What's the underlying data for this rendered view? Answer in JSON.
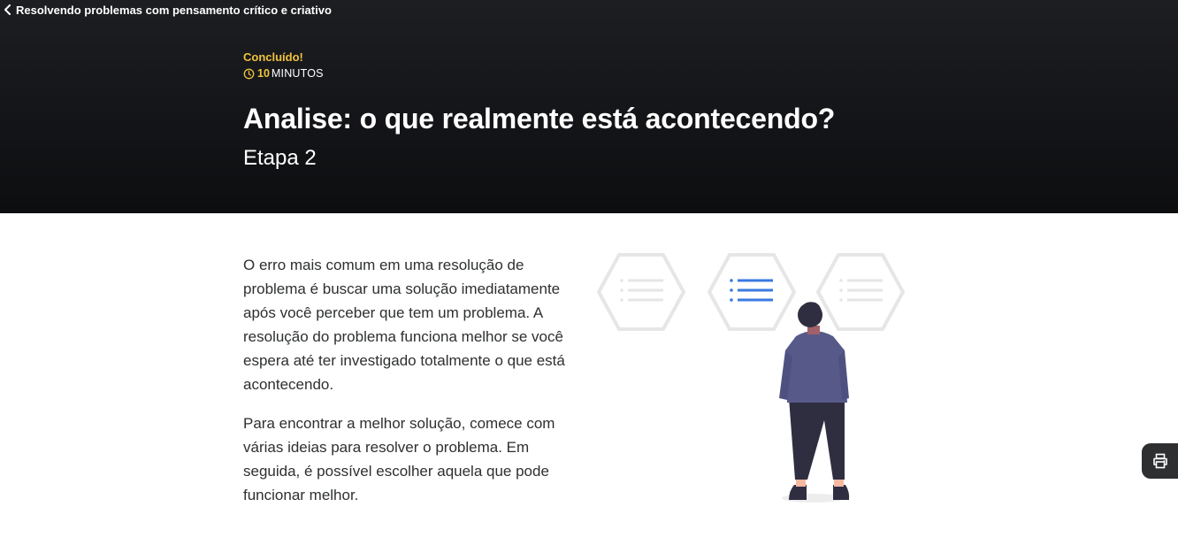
{
  "header": {
    "back_label": "Resolvendo problemas com pensamento crítico e criativo",
    "status": "Concluído!",
    "duration_value": "10",
    "duration_unit": "MINUTOS",
    "title": "Analise: o que realmente está acontecendo?",
    "subtitle": "Etapa 2"
  },
  "content": {
    "paragraphs": [
      "O erro mais comum em uma resolução de problema é buscar uma solução imediatamente após você perceber que tem um problema. A resolução do problema funciona melhor se você espera até ter investigado totalmente o que está acontecendo.",
      "Para encontrar a melhor solução, comece com várias ideias para resolver o problema. Em seguida, é possível escolher aquela que pode funcionar melhor."
    ]
  },
  "icons": {
    "back": "chevron-left-icon",
    "duration": "clock-icon",
    "print": "printer-icon"
  },
  "colors": {
    "accent": "#f0c33c",
    "hero_bg": "#141518",
    "highlight_list": "#3b7ae0",
    "person_hoodie": "#575a89",
    "person_pants": "#2f2e41",
    "hexagon_outline": "#e6e6e6"
  }
}
